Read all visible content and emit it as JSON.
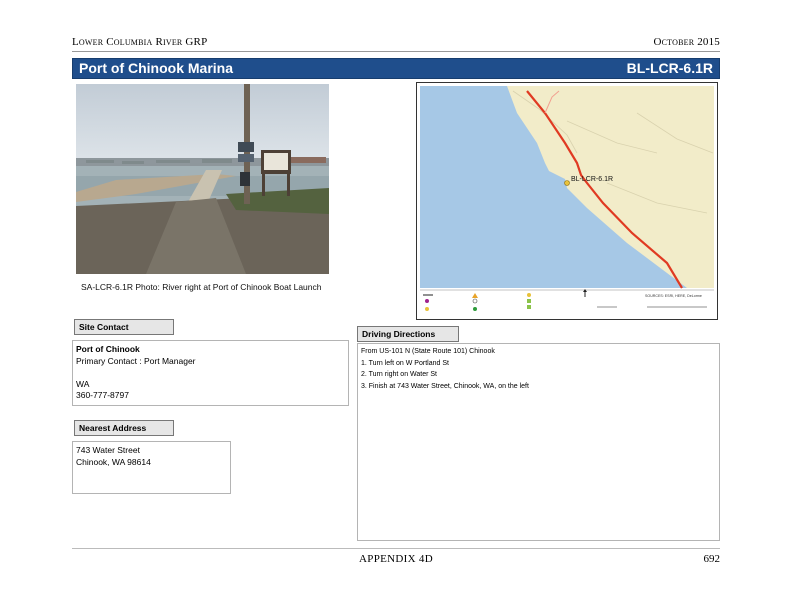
{
  "header": {
    "left": "Lower Columbia River GRP",
    "right": "October 2015"
  },
  "title": {
    "name": "Port of Chinook Marina",
    "code": "BL-LCR-6.1R"
  },
  "photo": {
    "caption": "SA-LCR-6.1R Photo: River right at Port of Chinook Boat Launch"
  },
  "map": {
    "site_label": "BL-LCR-6.1R",
    "scale_text": "SOURCES: ESRI, HERE, DeLorme",
    "colors": {
      "water": "#a6c8e6",
      "land": "#f2ecc9",
      "route": "#e03a22"
    }
  },
  "site_contact": {
    "label": "Site Contact",
    "org": "Port of Chinook",
    "primary": "Primary Contact : Port Manager",
    "blank": "",
    "state": "WA",
    "phone": "360-777-8797"
  },
  "nearest_address": {
    "label": "Nearest Address",
    "street": "743 Water Street",
    "city": "Chinook, WA  98614"
  },
  "driving_directions": {
    "label": "Driving Directions",
    "lines": [
      "From US-101 N (State Route 101) Chinook",
      "1. Turn left on W Portland St",
      "2. Turn right on Water St",
      "3. Finish at 743 Water Street, Chinook, WA, on the left"
    ]
  },
  "footer": {
    "center": "APPENDIX 4D",
    "page": "692"
  }
}
